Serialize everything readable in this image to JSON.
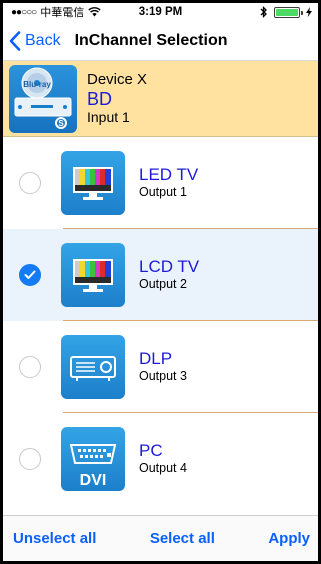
{
  "status_bar": {
    "carrier": "中華電信",
    "time": "3:19 PM"
  },
  "nav": {
    "back_label": "Back",
    "title": "InChannel Selection"
  },
  "device": {
    "name": "Device X",
    "type": "BD",
    "input": "Input 1"
  },
  "outputs": [
    {
      "name": "LED TV",
      "sub": "Output 1",
      "selected": false,
      "icon": "tv-color-bars-icon"
    },
    {
      "name": "LCD TV",
      "sub": "Output 2",
      "selected": true,
      "icon": "tv-color-bars-icon"
    },
    {
      "name": "DLP",
      "sub": "Output 3",
      "selected": false,
      "icon": "projector-icon"
    },
    {
      "name": "PC",
      "sub": "Output 4",
      "selected": false,
      "icon": "dvi-connector-icon",
      "icon_text": "DVI"
    }
  ],
  "toolbar": {
    "unselect_all": "Unselect all",
    "select_all": "Select all",
    "apply": "Apply"
  },
  "colors": {
    "accent": "#0A60FF",
    "device_header_bg": "#FFE2A0",
    "selected_row_bg": "#EAF2FB",
    "title_blue": "#1D1ADB"
  }
}
